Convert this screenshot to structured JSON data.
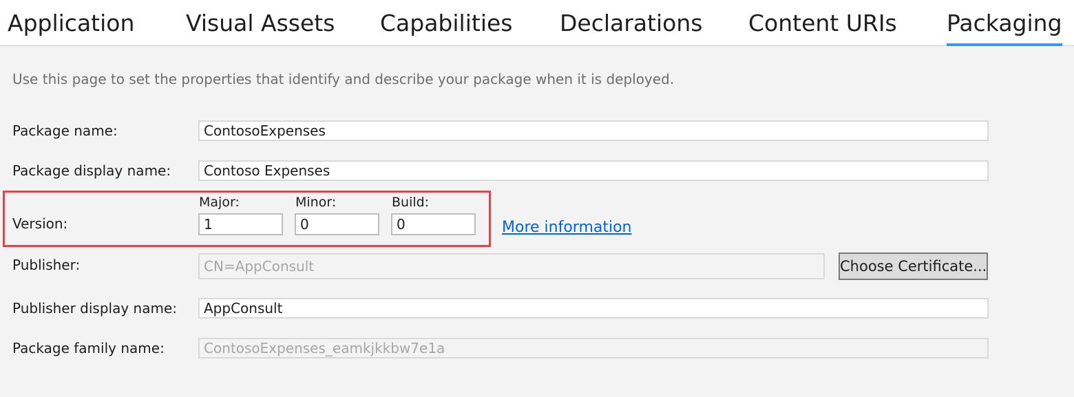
{
  "tabs": [
    {
      "label": "Application"
    },
    {
      "label": "Visual Assets"
    },
    {
      "label": "Capabilities"
    },
    {
      "label": "Declarations"
    },
    {
      "label": "Content URIs"
    },
    {
      "label": "Packaging",
      "active": true
    }
  ],
  "intro": "Use this page to set the properties that identify and describe your package when it is deployed.",
  "form": {
    "package_name": {
      "label": "Package name:",
      "value": "ContosoExpenses"
    },
    "package_display_name": {
      "label": "Package display name:",
      "value": "Contoso Expenses"
    },
    "version": {
      "label": "Version:",
      "major": {
        "label": "Major:",
        "value": "1"
      },
      "minor": {
        "label": "Minor:",
        "value": "0"
      },
      "build": {
        "label": "Build:",
        "value": "0"
      },
      "more_info": "More information"
    },
    "publisher": {
      "label": "Publisher:",
      "value": "CN=AppConsult",
      "button": "Choose Certificate..."
    },
    "publisher_display_name": {
      "label": "Publisher display name:",
      "value": "AppConsult"
    },
    "package_family_name": {
      "label": "Package family name:",
      "value": "ContosoExpenses_eamkjkkbw7e1a"
    }
  },
  "colors": {
    "accent": "#3399ff",
    "highlight": "#e04448",
    "link": "#0066cc"
  }
}
